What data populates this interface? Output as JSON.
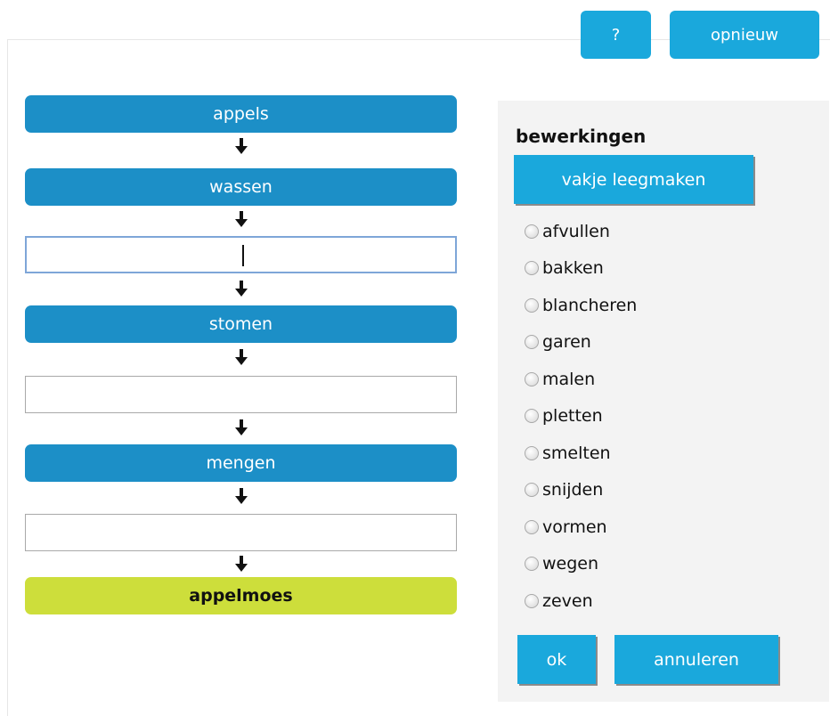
{
  "top_buttons": {
    "help": "?",
    "reset": "opnieuw"
  },
  "chain": [
    {
      "kind": "step",
      "label": "appels"
    },
    {
      "kind": "step",
      "label": "wassen"
    },
    {
      "kind": "slot",
      "value": "",
      "active": true
    },
    {
      "kind": "step",
      "label": "stomen"
    },
    {
      "kind": "slot",
      "value": ""
    },
    {
      "kind": "step",
      "label": "mengen"
    },
    {
      "kind": "slot",
      "value": ""
    },
    {
      "kind": "final",
      "label": "appelmoes"
    }
  ],
  "panel": {
    "title": "bewerkingen",
    "clear_button": "vakje leegmaken",
    "operations": [
      "afvullen",
      "bakken",
      "blancheren",
      "garen",
      "malen",
      "pletten",
      "smelten",
      "snijden",
      "vormen",
      "wegen",
      "zeven"
    ],
    "ok_button": "ok",
    "cancel_button": "annuleren"
  },
  "colors": {
    "step": "#1c8fc7",
    "final": "#cdde3b",
    "button": "#1aa8dc"
  }
}
